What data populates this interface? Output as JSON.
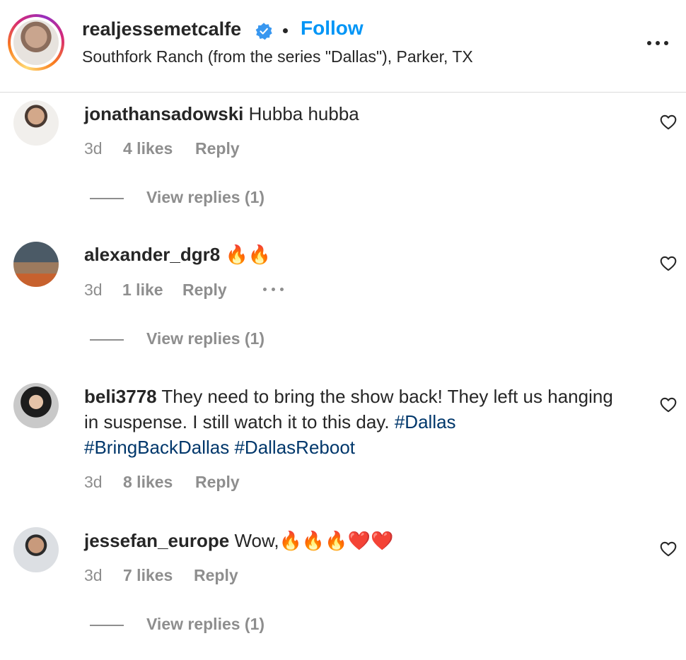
{
  "post": {
    "username": "realjessemetcalfe",
    "follow_label": "Follow",
    "location": "Southfork Ranch (from the series \"Dallas\"), Parker, TX",
    "verified": true
  },
  "comments": [
    {
      "username": "jonathansadowski",
      "text": "Hubba hubba",
      "time": "3d",
      "likes": "4 likes",
      "reply_label": "Reply",
      "view_replies": "View replies (1)"
    },
    {
      "username": "alexander_dgr8",
      "text": "🔥🔥",
      "time": "3d",
      "likes": "1 like",
      "reply_label": "Reply",
      "view_replies": "View replies (1)"
    },
    {
      "username": "beli3778",
      "text": "They need to bring the show back! They left us hanging in suspense. I still watch it to this day.",
      "hashtags": [
        "#Dallas",
        "#BringBackDallas",
        "#DallasReboot"
      ],
      "time": "3d",
      "likes": "8 likes",
      "reply_label": "Reply"
    },
    {
      "username": "jessefan_europe",
      "text": "Wow,🔥🔥🔥❤️❤️",
      "time": "3d",
      "likes": "7 likes",
      "reply_label": "Reply",
      "view_replies": "View replies (1)"
    }
  ],
  "icons": {
    "verified": "verified-badge-icon",
    "more": "more-horizontal-icon",
    "heart": "heart-outline-icon"
  },
  "colors": {
    "link_blue": "#0095f6",
    "hashtag": "#00376b",
    "muted": "#8e8e8e",
    "text": "#262626"
  }
}
